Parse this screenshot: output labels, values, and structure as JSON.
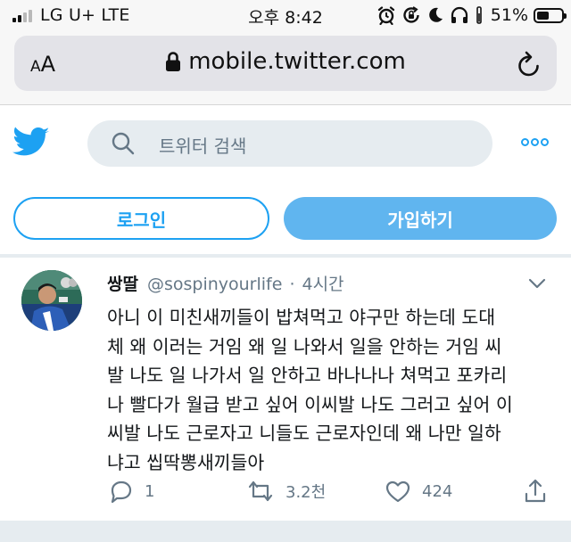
{
  "status_bar": {
    "carrier": "LG U+ LTE",
    "time": "오후 8:42",
    "battery_percent": "51%",
    "battery_level": 0.51,
    "icons": [
      "alarm-icon",
      "rotation-lock-icon",
      "moon-icon",
      "headphones-icon",
      "location-icon"
    ]
  },
  "browser": {
    "aa_large": "A",
    "aa_small": "A",
    "url": "mobile.twitter.com"
  },
  "header": {
    "search_placeholder": "트위터 검색"
  },
  "auth": {
    "login_label": "로그인",
    "signup_label": "가입하기"
  },
  "tweet": {
    "display_name": "쌍딸",
    "handle": "@sospinyourlife",
    "separator": "·",
    "time": "4시간",
    "lines": [
      "아니 이 미친새끼들이 밥쳐먹고 야구만 하는데 도대",
      "체 왜 이러는 거임 왜 일 나와서 일을 안하는 거임 씨",
      "발 나도 일 나가서 일 안하고 바나나나 쳐먹고 포카리",
      "나 빨다가 월급 받고 싶어 이씨발 나도 그러고 싶어 이",
      "씨발 나도 근로자고 니들도 근로자인데 왜 나만 일하",
      "냐고 씹딱뽕새끼들아"
    ],
    "replies": "1",
    "retweets": "3.2천",
    "likes": "424"
  },
  "colors": {
    "twitter_blue": "#1da1f2",
    "signup_fill": "#60b5ef",
    "secondary_text": "#657786",
    "search_bg": "#e6ecf0"
  }
}
